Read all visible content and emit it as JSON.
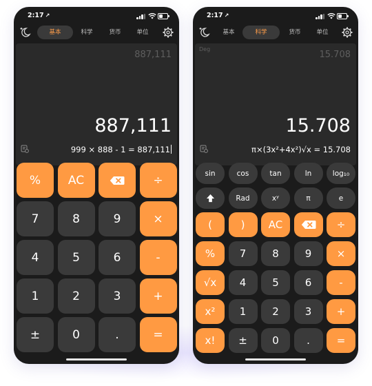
{
  "status": {
    "time": "2:17",
    "location_glyph": "↗"
  },
  "tabs": [
    "基本",
    "科学",
    "货币",
    "单位"
  ],
  "left": {
    "active_tab": "基本",
    "previous_result": "887,111",
    "result": "887,111",
    "expression": "999 × 888 - 1 = 887,111",
    "keys": [
      [
        "%",
        "AC",
        "backspace-icon",
        "÷"
      ],
      [
        "7",
        "8",
        "9",
        "×"
      ],
      [
        "4",
        "5",
        "6",
        "-"
      ],
      [
        "1",
        "2",
        "3",
        "+"
      ],
      [
        "±",
        "0",
        ".",
        "="
      ]
    ]
  },
  "right": {
    "active_tab": "科学",
    "angle_mode": "Deg",
    "previous_result": "15.708",
    "result": "15.708",
    "expression": "π×(3x²+4x²)√x = 15.708",
    "sci_keys": [
      [
        "sin",
        "cos",
        "tan",
        "ln",
        "log₁₀"
      ],
      [
        "shift-arrow-icon",
        "Rad",
        "xʸ",
        "π",
        "e"
      ]
    ],
    "keys": [
      [
        "(",
        ")",
        "AC",
        "backspace-icon",
        "÷"
      ],
      [
        "%",
        "7",
        "8",
        "9",
        "×"
      ],
      [
        "√x",
        "4",
        "5",
        "6",
        "-"
      ],
      [
        "x²",
        "1",
        "2",
        "3",
        "+"
      ],
      [
        "x!",
        "±",
        "0",
        ".",
        "="
      ]
    ]
  },
  "colors": {
    "accent": "#ff9a42",
    "key": "#3a3a3a",
    "display": "#2a2a2a",
    "background": "#1b1b1b"
  }
}
